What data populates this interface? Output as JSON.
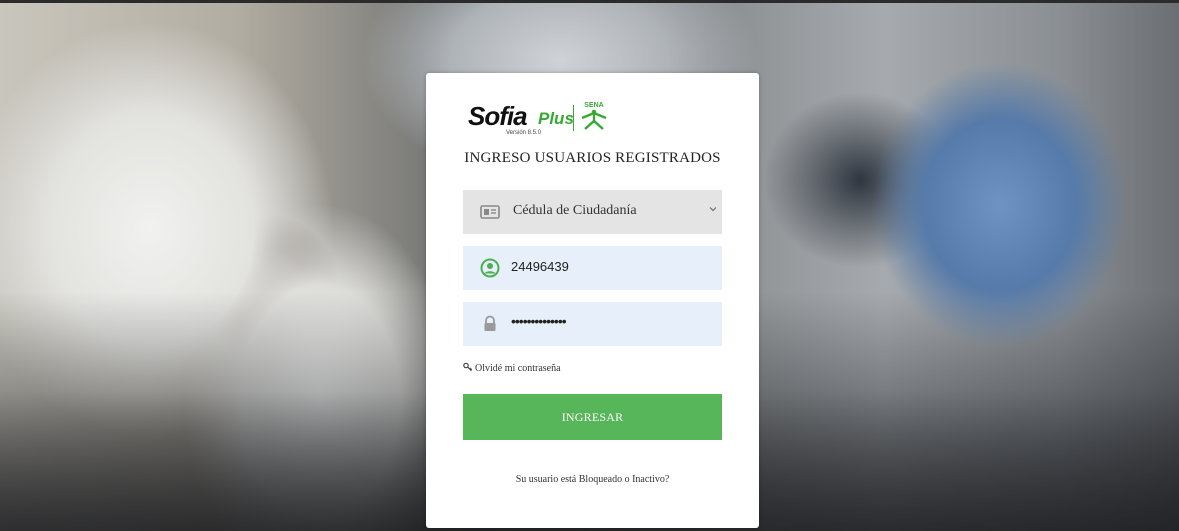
{
  "brand": {
    "logo_word": "Sofia",
    "logo_suffix": "Plus",
    "version": "Versión 8.5.0",
    "partner_mark": "SENA",
    "accent_color": "#39a935"
  },
  "login": {
    "title": "INGRESO USUARIOS REGISTRADOS",
    "document_type": {
      "selected": "Cédula de Ciudadanía",
      "icon": "id-card-icon"
    },
    "username": {
      "value": "24496439",
      "icon": "user-circle-icon"
    },
    "password": {
      "value": "••••••••••••••",
      "icon": "lock-icon"
    },
    "forgot_password": "Olvidé mi contraseña",
    "forgot_icon": "key-icon",
    "submit_label": "INGRESAR",
    "submit_color": "#57b65a",
    "blocked_link": "Su usuario está Bloqueado o Inactivo?"
  }
}
